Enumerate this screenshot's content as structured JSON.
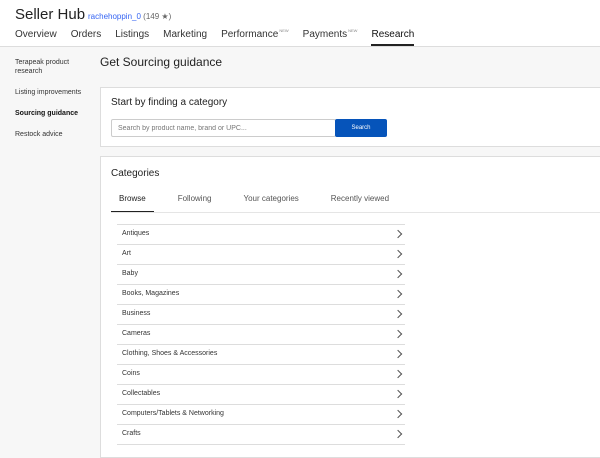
{
  "header": {
    "brand": "Seller Hub",
    "user": "rachehoppin_0",
    "feedback": "(149 ★)",
    "nav": [
      {
        "label": "Overview",
        "sup": ""
      },
      {
        "label": "Orders",
        "sup": ""
      },
      {
        "label": "Listings",
        "sup": ""
      },
      {
        "label": "Marketing",
        "sup": ""
      },
      {
        "label": "Performance",
        "sup": "NEW"
      },
      {
        "label": "Payments",
        "sup": "NEW"
      },
      {
        "label": "Research",
        "sup": ""
      }
    ]
  },
  "sidebar": {
    "items": [
      {
        "label": "Terapeak product research"
      },
      {
        "label": "Listing improvements"
      },
      {
        "label": "Sourcing guidance"
      },
      {
        "label": "Restock advice"
      }
    ]
  },
  "main": {
    "title": "Get Sourcing guidance",
    "search_card": {
      "title": "Start by finding a category",
      "placeholder": "Search by product name, brand or UPC...",
      "button": "Search"
    },
    "categories_card": {
      "title": "Categories",
      "tabs": [
        "Browse",
        "Following",
        "Your categories",
        "Recently viewed"
      ],
      "items": [
        "Antiques",
        "Art",
        "Baby",
        "Books, Magazines",
        "Business",
        "Cameras",
        "Clothing, Shoes & Accessories",
        "Coins",
        "Collectables",
        "Computers/Tablets & Networking",
        "Crafts"
      ]
    }
  }
}
